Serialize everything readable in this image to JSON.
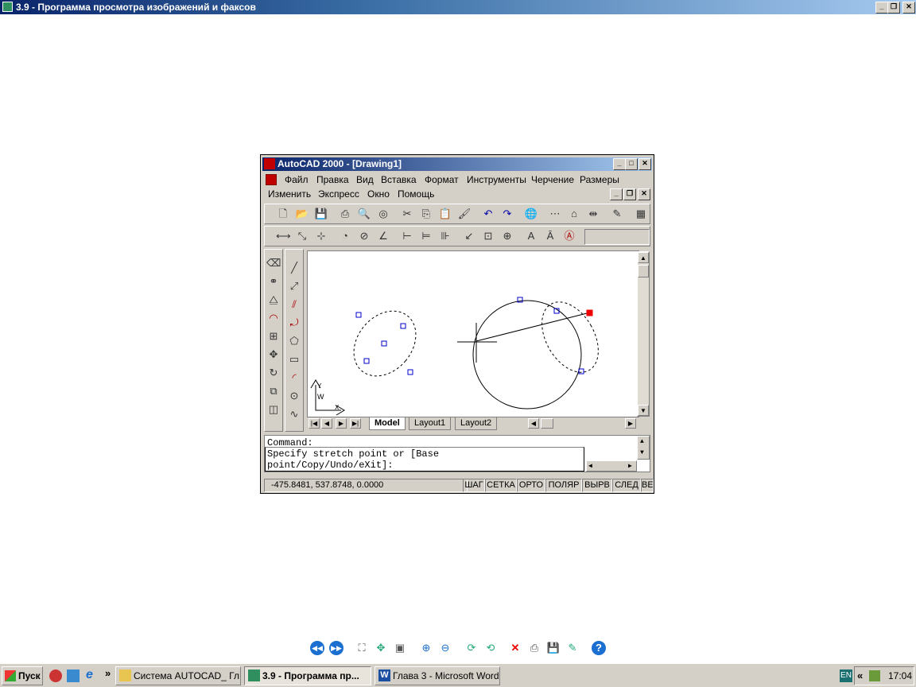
{
  "viewer": {
    "title": "3.9 - Программа просмотра изображений и факсов"
  },
  "acad": {
    "title": "AutoCAD 2000 - [Drawing1]",
    "menu_row1": [
      "Файл",
      "Правка",
      "Вид",
      "Вставка",
      "Формат",
      "Инструменты",
      "Черчение",
      "Размеры"
    ],
    "menu_row2": [
      "Изменить",
      "Экспресс",
      "Окно",
      "Помощь"
    ],
    "layout_tabs": [
      "Model",
      "Layout1",
      "Layout2"
    ],
    "ucs_labels": {
      "y": "Y",
      "w": "W",
      "x": "X"
    },
    "command_lines": [
      "Command:",
      "Specify stretch point or [Base",
      "point/Copy/Undo/eXit]:"
    ],
    "coordinates": "-475.8481, 537.8748, 0.0000",
    "status_toggles": [
      "ШАГ",
      "СЕТКА",
      "ОРТО",
      "ПОЛЯР",
      "ВЫРВ",
      "СЛЕД",
      "ВЕ"
    ]
  },
  "taskbar": {
    "start_label": "Пуск",
    "tasks": [
      {
        "label": "Система AUTOCAD_ Гл..."
      },
      {
        "label": "3.9 - Программа пр..."
      },
      {
        "label": "Глава 3 - Microsoft Word"
      }
    ],
    "language": "EN",
    "clock": "17:04",
    "chevron": "»",
    "tray_chevron": "«"
  },
  "icons": {
    "window_controls": [
      "minimize-icon",
      "maximize-icon",
      "close-icon"
    ]
  }
}
